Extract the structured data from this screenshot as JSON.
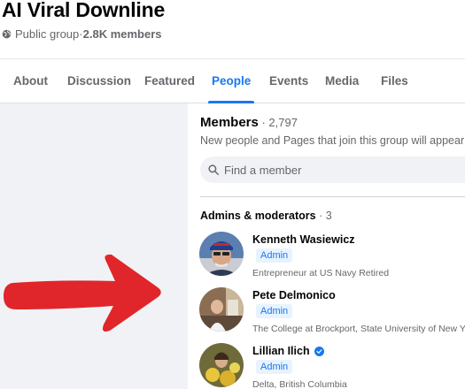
{
  "group": {
    "name": "AI Viral Downline",
    "privacy": "Public group",
    "separator": " · ",
    "members_count": "2.8K members"
  },
  "tabs": [
    {
      "label": "About"
    },
    {
      "label": "Discussion"
    },
    {
      "label": "Featured"
    },
    {
      "label": "People",
      "active": true
    },
    {
      "label": "Events"
    },
    {
      "label": "Media"
    },
    {
      "label": "Files"
    }
  ],
  "members": {
    "title": "Members",
    "separator": " · ",
    "count": "2,797",
    "subtitle": "New people and Pages that join this group will appear here.",
    "search_placeholder": "Find a member"
  },
  "admins": {
    "title": "Admins & moderators",
    "separator": " · ",
    "count": "3",
    "list": [
      {
        "name": "Kenneth Wasiewicz",
        "role": "Admin",
        "description": "Entrepreneur at US Navy Retired",
        "verified": false
      },
      {
        "name": "Pete Delmonico",
        "role": "Admin",
        "description": "The College at Brockport, State University of New York",
        "verified": false
      },
      {
        "name": "Lillian Ilich",
        "role": "Admin",
        "description": "Delta, British Columbia",
        "verified": true
      }
    ]
  },
  "colors": {
    "accent": "#1877f2",
    "arrow": "#e0262b",
    "secondary_text": "#65676b",
    "page_bg": "#f0f2f5"
  },
  "icons": {
    "privacy": "globe-icon",
    "search": "search-icon",
    "verified": "verified-badge-icon",
    "annotation": "red-arrow"
  }
}
